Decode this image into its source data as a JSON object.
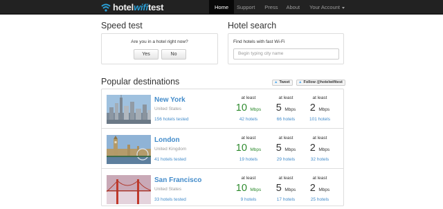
{
  "brand": {
    "part1": "hotel",
    "part2": "wifi",
    "part3": "test"
  },
  "nav": {
    "items": [
      {
        "label": "Home"
      },
      {
        "label": "Support"
      },
      {
        "label": "Press"
      },
      {
        "label": "About"
      },
      {
        "label": "Your Account"
      }
    ]
  },
  "speed_test": {
    "title": "Speed test",
    "question": "Are you in a hotel right now?",
    "yes_label": "Yes",
    "no_label": "No"
  },
  "hotel_search": {
    "title": "Hotel search",
    "label": "Find hotels with fast Wi-Fi",
    "placeholder": "Begin typing city name"
  },
  "popular": {
    "title": "Popular destinations",
    "tweet_label": "Tweet",
    "follow_label": "Follow @hotelwifitest",
    "at_least": "at least",
    "unit": "Mbps",
    "destinations": [
      {
        "city": "New York",
        "country": "United States",
        "tested": "156 hotels tested",
        "speeds": [
          {
            "value": "10",
            "hotels": "42 hotels"
          },
          {
            "value": "5",
            "hotels": "66 hotels"
          },
          {
            "value": "2",
            "hotels": "101 hotels"
          }
        ]
      },
      {
        "city": "London",
        "country": "United Kingdom",
        "tested": "41 hotels tested",
        "speeds": [
          {
            "value": "10",
            "hotels": "19 hotels"
          },
          {
            "value": "5",
            "hotels": "29 hotels"
          },
          {
            "value": "2",
            "hotels": "32 hotels"
          }
        ]
      },
      {
        "city": "San Francisco",
        "country": "United States",
        "tested": "33 hotels tested",
        "speeds": [
          {
            "value": "10",
            "hotels": "9 hotels"
          },
          {
            "value": "5",
            "hotels": "17 hotels"
          },
          {
            "value": "2",
            "hotels": "25 hotels"
          }
        ]
      }
    ]
  }
}
